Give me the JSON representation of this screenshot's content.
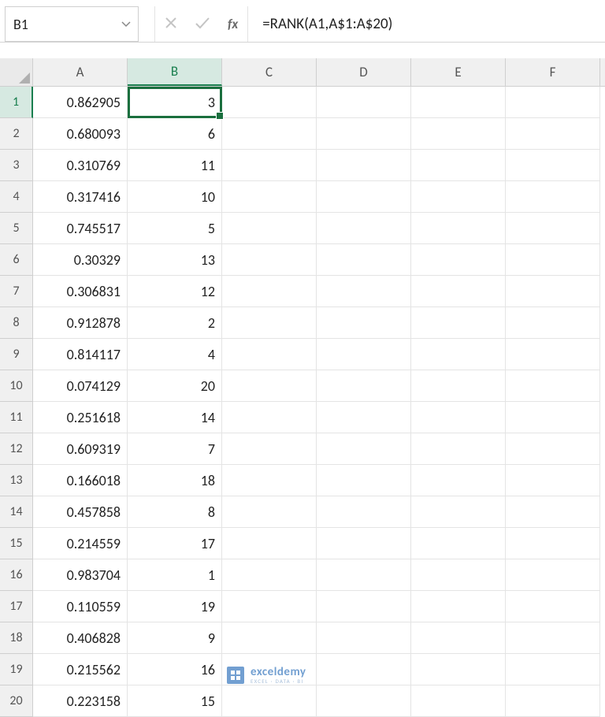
{
  "namebox": "B1",
  "formula": "=RANK(A1,A$1:A$20)",
  "columns": [
    "A",
    "B",
    "C",
    "D",
    "E",
    "F"
  ],
  "selectedColumn": "B",
  "selectedRow": 1,
  "rows": [
    {
      "n": 1,
      "a": "0.862905",
      "b": "3"
    },
    {
      "n": 2,
      "a": "0.680093",
      "b": "6"
    },
    {
      "n": 3,
      "a": "0.310769",
      "b": "11"
    },
    {
      "n": 4,
      "a": "0.317416",
      "b": "10"
    },
    {
      "n": 5,
      "a": "0.745517",
      "b": "5"
    },
    {
      "n": 6,
      "a": "0.30329",
      "b": "13"
    },
    {
      "n": 7,
      "a": "0.306831",
      "b": "12"
    },
    {
      "n": 8,
      "a": "0.912878",
      "b": "2"
    },
    {
      "n": 9,
      "a": "0.814117",
      "b": "4"
    },
    {
      "n": 10,
      "a": "0.074129",
      "b": "20"
    },
    {
      "n": 11,
      "a": "0.251618",
      "b": "14"
    },
    {
      "n": 12,
      "a": "0.609319",
      "b": "7"
    },
    {
      "n": 13,
      "a": "0.166018",
      "b": "18"
    },
    {
      "n": 14,
      "a": "0.457858",
      "b": "8"
    },
    {
      "n": 15,
      "a": "0.214559",
      "b": "17"
    },
    {
      "n": 16,
      "a": "0.983704",
      "b": "1"
    },
    {
      "n": 17,
      "a": "0.110559",
      "b": "19"
    },
    {
      "n": 18,
      "a": "0.406828",
      "b": "9"
    },
    {
      "n": 19,
      "a": "0.215562",
      "b": "16"
    },
    {
      "n": 20,
      "a": "0.223158",
      "b": "15"
    }
  ],
  "watermark": {
    "title": "exceldemy",
    "sub": "EXCEL · DATA · BI"
  }
}
